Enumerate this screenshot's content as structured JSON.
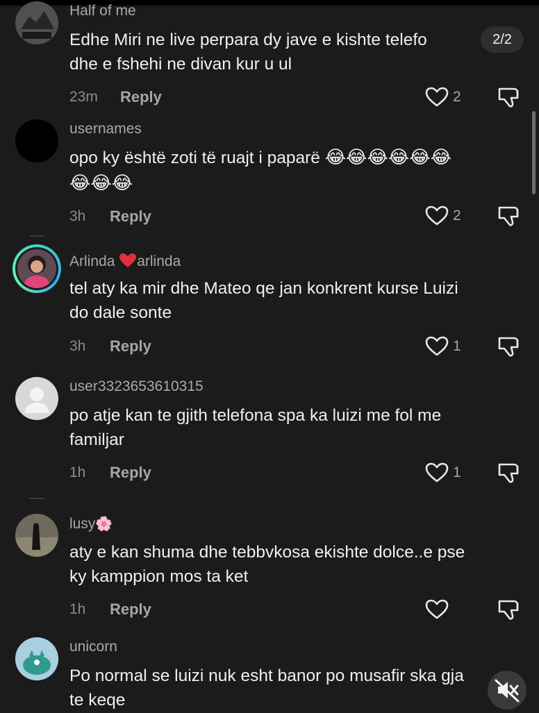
{
  "pager": "2/2",
  "comments": [
    {
      "username": "Half of me",
      "text": "Edhe Miri ne live perpara dy jave e kishte telefo",
      "text2": "dhe e fshehi ne divan kur u ul",
      "time": "23m",
      "reply": "Reply",
      "likes": "2"
    },
    {
      "username": "usernames",
      "text": "opo ky është zoti të ruajt i paparë",
      "emoji": "😂",
      "time": "3h",
      "reply": "Reply",
      "likes": "2"
    },
    {
      "username": "Arlinda",
      "username_suffix": "arlinda",
      "text": "tel aty ka mir dhe Mateo qe jan konkrent kurse Luizi",
      "text2": "do dale sonte",
      "time": "3h",
      "reply": "Reply",
      "likes": "1"
    },
    {
      "username": "user3323653610315",
      "text": "po atje kan te gjith telefona spa ka luizi me fol me",
      "text2": "familjar",
      "time": "1h",
      "reply": "Reply",
      "likes": "1"
    },
    {
      "username": "lusy",
      "username_emoji": "🌸",
      "text": "aty e kan shuma dhe tebbvkosa ekishte dolce..e pse",
      "text2": "ky kamppion mos ta ket",
      "time": "1h",
      "reply": "Reply",
      "likes": ""
    },
    {
      "username": "unicorn",
      "text": "Po normal se luizi nuk esht banor po musafir ska gja",
      "text2": "te keqe"
    }
  ]
}
